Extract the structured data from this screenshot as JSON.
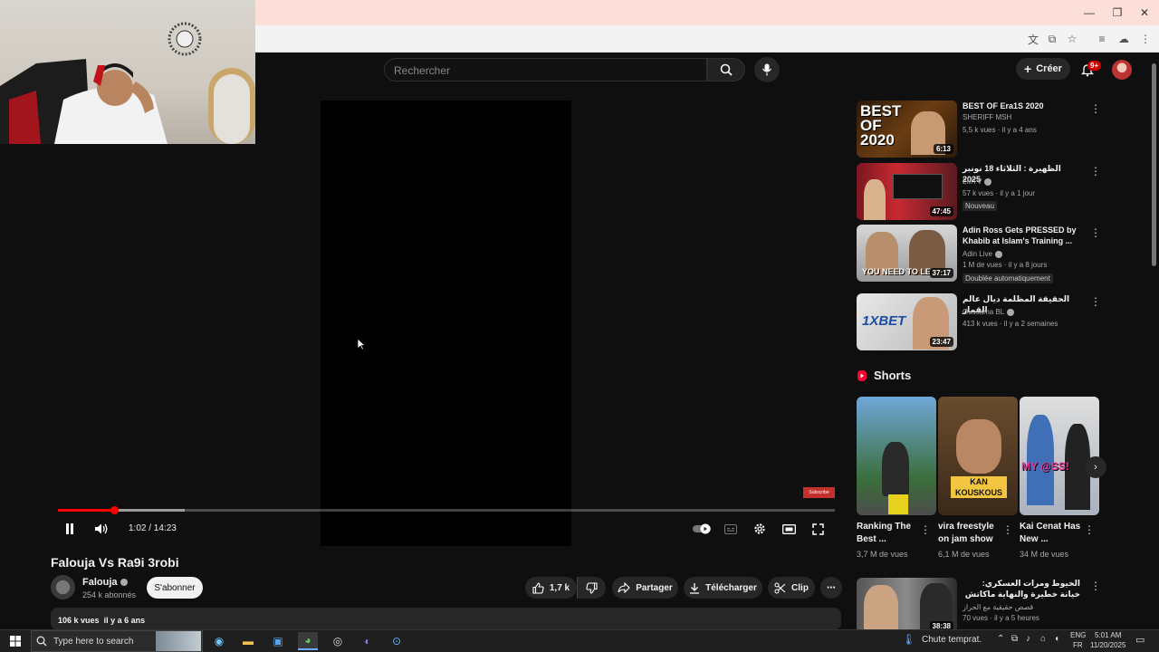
{
  "search": {
    "placeholder": "Rechercher"
  },
  "header": {
    "create_label": "Créer",
    "notif_badge": "9+"
  },
  "player": {
    "time": "1:02 / 14:23",
    "progress_fraction": 0.0723,
    "watermark": "Subscribe"
  },
  "video": {
    "title": "Falouja Vs Ra9i 3robi",
    "channel": "Falouja",
    "subscribers": "254 k abonnés",
    "subscribe_label": "S'abonner",
    "likes": "1,7 k",
    "share_label": "Partager",
    "download_label": "Télécharger",
    "clip_label": "Clip",
    "views": "106 k vues",
    "age": "il y a 6 ans"
  },
  "recommendations": [
    {
      "title": "BEST OF  Era1S  2020",
      "channel": "SHERIFF MSH",
      "meta": "5,5 k vues · il y a 4 ans",
      "duration": "6:13",
      "tag": ""
    },
    {
      "title": "الظهيرة : الثلاثاء 18 نونبر 2025",
      "channel": "2MTV",
      "meta": "57 k vues · il y a 1 jour",
      "duration": "47:45",
      "tag": "Nouveau"
    },
    {
      "title": "Adin Ross Gets PRESSED by Khabib at Islam's Training ...",
      "channel": "Adin Live",
      "meta": "1 M de vues · il y a 8 jours",
      "duration": "37:17",
      "tag": "Doublée automatiquement",
      "thumb_text": "YOU NEED TO LE"
    },
    {
      "title": "الحقيقة المظلمة ديال عالم القمار",
      "channel": "Oussama BL",
      "meta": "413 k vues · il y a 2 semaines",
      "duration": "23:47",
      "tag": "",
      "thumb_text": "1XBET"
    }
  ],
  "rec_thumb_text_0": "BEST OF 2020",
  "shorts": {
    "heading": "Shorts",
    "items": [
      {
        "title": "Ranking The Best ...",
        "views": "3,7 M de vues"
      },
      {
        "title": "vira freestyle on jam show",
        "views": "6,1 M de vues",
        "thumb_text": "KAN KOUSKOUS"
      },
      {
        "title": "Kai Cenat Has New ...",
        "views": "34 M de vues",
        "thumb_text": "MY @SS!"
      }
    ]
  },
  "rec_bottom": {
    "title": "الخيوط ومرات العسكري: خيانة خطيرة والنهاية ماكاتش فالحساب | قصة واقعية",
    "channel": "قصص حقيقية مع الحراز",
    "meta": "70 vues · il y a 5 heures",
    "duration": "38:38"
  },
  "taskbar": {
    "search_placeholder": "Type here to search",
    "weather": "Chute temprat.",
    "lang1": "ENG",
    "lang2": "FR",
    "time": "5:01 AM",
    "date": "11/20/2025"
  }
}
